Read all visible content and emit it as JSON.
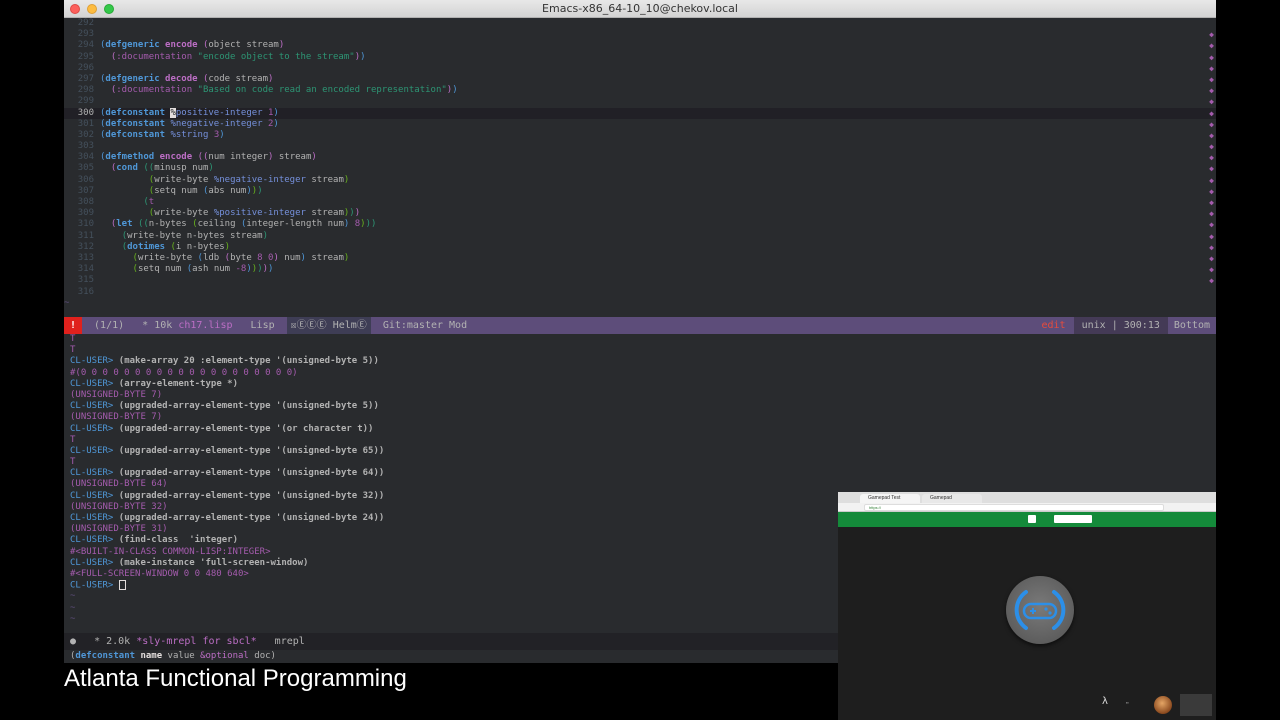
{
  "window": {
    "title": "Emacs-x86_64-10_10@chekov.local"
  },
  "code_lines": [
    {
      "n": "292",
      "html": ""
    },
    {
      "n": "293",
      "html": ""
    },
    {
      "n": "294",
      "html": "<span class='p1'>(</span><span class='kw'>defgeneric</span> <span class='fn'>encode</span> <span class='p2'>(</span>object stream<span class='p2'>)</span>"
    },
    {
      "n": "295",
      "html": "  <span class='p2'>(</span><span class='kwd'>:documentation</span> <span class='str'>\"encode object to the stream\"</span><span class='p2'>)</span><span class='p1'>)</span>"
    },
    {
      "n": "296",
      "html": ""
    },
    {
      "n": "297",
      "html": "<span class='p1'>(</span><span class='kw'>defgeneric</span> <span class='fn'>decode</span> <span class='p2'>(</span>code stream<span class='p2'>)</span>"
    },
    {
      "n": "298",
      "html": "  <span class='p2'>(</span><span class='kwd'>:documentation</span> <span class='str'>\"Based on code read an encoded representation\"</span><span class='p2'>)</span><span class='p1'>)</span>"
    },
    {
      "n": "299",
      "html": ""
    },
    {
      "n": "300",
      "current": true,
      "html": "<span class='p1'>(</span><span class='kw'>defconstant</span> <span class='cursorbox'>%</span><span class='var'>positive-integer</span> <span class='num'>1</span><span class='p1'>)</span>"
    },
    {
      "n": "301",
      "html": "<span class='p1'>(</span><span class='kw'>defconstant</span> <span class='var'>%negative-integer</span> <span class='num'>2</span><span class='p1'>)</span>"
    },
    {
      "n": "302",
      "html": "<span class='p1'>(</span><span class='kw'>defconstant</span> <span class='var'>%string</span> <span class='num'>3</span><span class='p1'>)</span>"
    },
    {
      "n": "303",
      "html": ""
    },
    {
      "n": "304",
      "html": "<span class='p1'>(</span><span class='kw'>defmethod</span> <span class='fn'>encode</span> <span class='p2'>((</span>num integer<span class='p2'>)</span> stream<span class='p2'>)</span>"
    },
    {
      "n": "305",
      "html": "  <span class='p2'>(</span><span class='kw'>cond</span> <span class='p3'>((</span>minusp num<span class='p3'>)</span>"
    },
    {
      "n": "306",
      "html": "         <span class='p4'>(</span>write-byte <span class='var'>%negative-integer</span> stream<span class='p4'>)</span>"
    },
    {
      "n": "307",
      "html": "         <span class='p4'>(</span>setq num <span class='p1'>(</span>abs num<span class='p1'>)</span><span class='p4'>)</span><span class='p3'>)</span>"
    },
    {
      "n": "308",
      "html": "        <span class='p3'>(</span><span class='kwd'>t</span>"
    },
    {
      "n": "309",
      "html": "         <span class='p4'>(</span>write-byte <span class='var'>%positive-integer</span> stream<span class='p4'>)</span><span class='p3'>)</span><span class='p2'>)</span>"
    },
    {
      "n": "310",
      "html": "  <span class='p2'>(</span><span class='kw'>let</span> <span class='p3'>((</span>n-bytes <span class='p4'>(</span>ceiling <span class='p1'>(</span>integer-length num<span class='p1'>)</span> <span class='num'>8</span><span class='p4'>)</span><span class='p3'>))</span>"
    },
    {
      "n": "311",
      "html": "    <span class='p3'>(</span>write-byte n-bytes stream<span class='p3'>)</span>"
    },
    {
      "n": "312",
      "html": "    <span class='p3'>(</span><span class='kw'>dotimes</span> <span class='p4'>(</span>i n-bytes<span class='p4'>)</span>"
    },
    {
      "n": "313",
      "html": "      <span class='p4'>(</span>write-byte <span class='p1'>(</span>ldb <span class='p2'>(</span>byte <span class='num'>8</span> <span class='num'>0</span><span class='p2'>)</span> num<span class='p1'>)</span> stream<span class='p4'>)</span>"
    },
    {
      "n": "314",
      "html": "      <span class='p4'>(</span>setq num <span class='p1'>(</span>ash num <span class='num'>-8</span><span class='p1'>)</span><span class='p4'>)</span><span class='p3'>)</span><span class='p2'>)</span><span class='p1'>)</span>"
    },
    {
      "n": "315",
      "html": ""
    },
    {
      "n": "316",
      "html": ""
    }
  ],
  "modeline_top": {
    "warn": "!",
    "count": "(1/1)",
    "buffer_size": "* 10k",
    "filename": "ch17.lisp",
    "mode": "Lisp",
    "helm": "☒ⒺⒺⒺ HelmⒺ",
    "vc": "Git:master Mod",
    "state": "edit",
    "encoding": "unix | 300:13",
    "position": "Bottom"
  },
  "repl": [
    {
      "t": "out",
      "text": "T"
    },
    {
      "t": "out",
      "text": "T"
    },
    {
      "t": "in",
      "text": "(make-array 20 :element-type '(unsigned-byte 5))"
    },
    {
      "t": "out",
      "text": "#(0 0 0 0 0 0 0 0 0 0 0 0 0 0 0 0 0 0 0 0)"
    },
    {
      "t": "in",
      "text": "(array-element-type *)"
    },
    {
      "t": "out",
      "text": "(UNSIGNED-BYTE 7)"
    },
    {
      "t": "in",
      "text": "(upgraded-array-element-type '(unsigned-byte 5))"
    },
    {
      "t": "out",
      "text": "(UNSIGNED-BYTE 7)"
    },
    {
      "t": "in",
      "text": "(upgraded-array-element-type '(or character t))"
    },
    {
      "t": "out",
      "text": "T"
    },
    {
      "t": "in",
      "text": "(upgraded-array-element-type '(unsigned-byte 65))"
    },
    {
      "t": "out",
      "text": "T"
    },
    {
      "t": "in",
      "text": "(upgraded-array-element-type '(unsigned-byte 64))"
    },
    {
      "t": "out",
      "text": "(UNSIGNED-BYTE 64)"
    },
    {
      "t": "in",
      "text": "(upgraded-array-element-type '(unsigned-byte 32))"
    },
    {
      "t": "out",
      "text": "(UNSIGNED-BYTE 32)"
    },
    {
      "t": "in",
      "text": "(upgraded-array-element-type '(unsigned-byte 24))"
    },
    {
      "t": "out",
      "text": "(UNSIGNED-BYTE 31)"
    },
    {
      "t": "in",
      "text": "(find-class  'integer)"
    },
    {
      "t": "out",
      "text": "#<BUILT-IN-CLASS COMMON-LISP:INTEGER>"
    },
    {
      "t": "in",
      "text": "(make-instance 'full-screen-window)"
    },
    {
      "t": "out",
      "text": "#<FULL-SCREEN-WINDOW 0 0 480 640>"
    },
    {
      "t": "prompt",
      "text": ""
    },
    {
      "t": "tilde",
      "text": "~"
    },
    {
      "t": "tilde",
      "text": "~"
    },
    {
      "t": "tilde",
      "text": "~"
    }
  ],
  "repl_prompt": "CL-USER> ",
  "modeline_bottom": {
    "dot": "●",
    "size": "* 2.0k",
    "buffer": "*sly-mrepl for sbcl*",
    "mode": "mrepl"
  },
  "echo": {
    "open": "(",
    "kw": "defconstant",
    "name": "name",
    "rest": " value ",
    "opt": "&optional",
    "end": " doc)"
  },
  "caption": "Atlanta Functional Programming",
  "webcam": {
    "tab1": "Gamepad Test",
    "tab2": "Gamepad",
    "url": "https://"
  }
}
